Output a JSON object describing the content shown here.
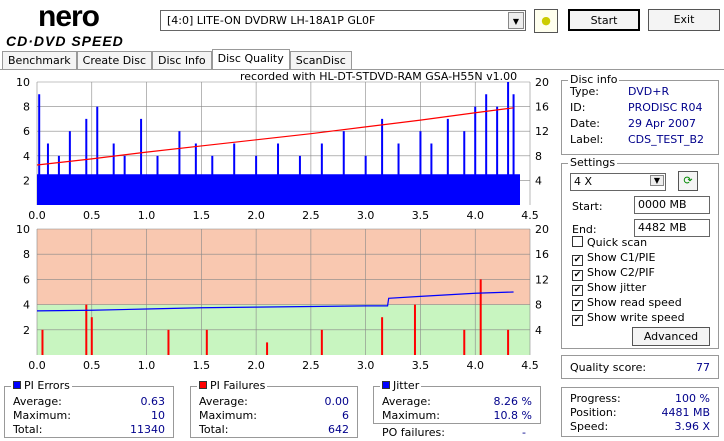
{
  "app": {
    "logo_top": "nero",
    "logo_bottom": "CD·DVD SPEED"
  },
  "toolbar": {
    "drive": "[4:0]  LITE-ON DVDRW LH-18A1P GL0F",
    "start": "Start",
    "exit": "Exit"
  },
  "tabs": [
    "Benchmark",
    "Create Disc",
    "Disc Info",
    "Disc Quality",
    "ScanDisc"
  ],
  "chart_caption": "recorded with HL-DT-STDVD-RAM GSA-H55N v1.00",
  "disc_info": {
    "title": "Disc info",
    "type_label": "Type:",
    "type": "DVD+R",
    "id_label": "ID:",
    "id": "PRODISC R04",
    "date_label": "Date:",
    "date": "29 Apr 2007",
    "label_label": "Label:",
    "label": "CDS_TEST_B2"
  },
  "settings": {
    "title": "Settings",
    "speed": "4 X",
    "start_label": "Start:",
    "start": "0000 MB",
    "end_label": "End:",
    "end": "4482 MB",
    "checks": [
      {
        "label": "Quick scan",
        "checked": false
      },
      {
        "label": "Show C1/PIE",
        "checked": true
      },
      {
        "label": "Show C2/PIF",
        "checked": true
      },
      {
        "label": "Show jitter",
        "checked": true
      },
      {
        "label": "Show read speed",
        "checked": true
      },
      {
        "label": "Show write speed",
        "checked": true
      }
    ],
    "advanced": "Advanced"
  },
  "quality": {
    "label": "Quality score:",
    "value": "77"
  },
  "progress": {
    "progress_label": "Progress:",
    "progress": "100 %",
    "position_label": "Position:",
    "position": "4481 MB",
    "speed_label": "Speed:",
    "speed": "3.96 X"
  },
  "pi_errors": {
    "title": "PI Errors",
    "avg_label": "Average:",
    "avg": "0.63",
    "max_label": "Maximum:",
    "max": "10",
    "total_label": "Total:",
    "total": "11340"
  },
  "pi_failures": {
    "title": "PI Failures",
    "avg_label": "Average:",
    "avg": "0.00",
    "max_label": "Maximum:",
    "max": "6",
    "total_label": "Total:",
    "total": "642"
  },
  "jitter": {
    "title": "Jitter",
    "avg_label": "Average:",
    "avg": "8.26 %",
    "max_label": "Maximum:",
    "max": "10.8 %",
    "po_label": "PO failures:",
    "po": "-"
  },
  "colors": {
    "pie": "#0000ff",
    "pif": "#ff0000",
    "jitter": "#0000ff",
    "speed": "#ff0000",
    "bad": "#f9c8b0",
    "good": "#c8f5c0"
  },
  "chart_data": [
    {
      "type": "bar",
      "name": "PI errors / read speed",
      "xlim": [
        0,
        4.5
      ],
      "ylim": [
        0,
        10
      ],
      "y2lim": [
        0,
        20
      ],
      "xticks": [
        "0.0",
        "0.5",
        "1.0",
        "1.5",
        "2.0",
        "2.5",
        "3.0",
        "3.5",
        "4.0",
        "4.5"
      ],
      "yticks": [
        "2",
        "4",
        "6",
        "8",
        "10"
      ],
      "y2ticks": [
        "4",
        "8",
        "12",
        "16",
        "20"
      ],
      "pie_x": [
        0.02,
        0.1,
        0.2,
        0.3,
        0.45,
        0.55,
        0.7,
        0.8,
        0.95,
        1.1,
        1.3,
        1.45,
        1.6,
        1.8,
        2.0,
        2.2,
        2.4,
        2.6,
        2.8,
        3.0,
        3.15,
        3.3,
        3.5,
        3.6,
        3.75,
        3.9,
        4.0,
        4.1,
        4.2,
        4.3,
        4.35
      ],
      "pie_y": [
        9,
        5,
        4,
        6,
        7,
        8,
        5,
        4,
        7,
        4,
        6,
        5,
        4,
        5,
        4,
        5,
        4,
        5,
        6,
        4,
        7,
        5,
        6,
        5,
        7,
        6,
        8,
        9,
        8,
        10,
        9
      ],
      "speed_x": [
        0,
        0.5,
        1.0,
        1.5,
        2.0,
        2.5,
        3.0,
        3.5,
        4.0,
        4.35
      ],
      "speed_y": [
        6.5,
        7.5,
        8.6,
        9.6,
        10.6,
        11.6,
        12.7,
        13.8,
        15.0,
        15.8
      ]
    },
    {
      "type": "bar",
      "name": "PI failures / jitter",
      "xlim": [
        0,
        4.5
      ],
      "ylim": [
        0,
        10
      ],
      "y2lim": [
        0,
        20
      ],
      "xticks": [
        "0.0",
        "0.5",
        "1.0",
        "1.5",
        "2.0",
        "2.5",
        "3.0",
        "3.5",
        "4.0",
        "4.5"
      ],
      "yticks": [
        "2",
        "4",
        "6",
        "8",
        "10"
      ],
      "y2ticks": [
        "4",
        "8",
        "12",
        "16",
        "20"
      ],
      "pif_x": [
        0.05,
        0.45,
        0.5,
        1.2,
        1.55,
        2.1,
        2.6,
        3.15,
        3.45,
        3.9,
        4.05,
        4.3
      ],
      "pif_y": [
        2,
        4,
        3,
        2,
        2,
        1,
        2,
        3,
        4,
        2,
        6,
        2
      ],
      "jitter_x": [
        0,
        0.5,
        1.0,
        1.5,
        2.0,
        2.5,
        3.0,
        3.2,
        3.21,
        3.5,
        4.0,
        4.35
      ],
      "jitter_y": [
        7.0,
        7.1,
        7.3,
        7.5,
        7.6,
        7.7,
        7.8,
        7.8,
        9.0,
        9.3,
        9.8,
        10.0
      ]
    }
  ]
}
